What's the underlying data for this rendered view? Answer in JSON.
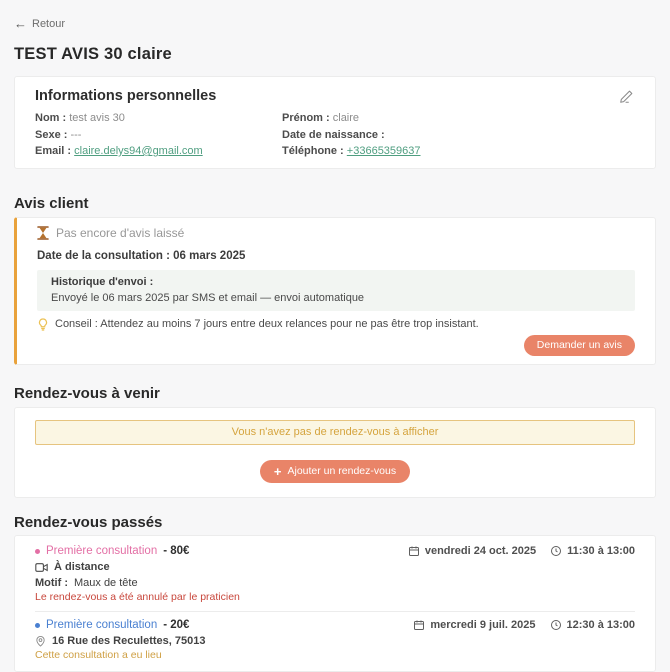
{
  "icons": {
    "back_arrow": "←",
    "plus": "+"
  },
  "header": {
    "back_label": "Retour",
    "title": "TEST AVIS 30 claire"
  },
  "personal_info": {
    "title": "Informations personnelles",
    "nom_label": "Nom :",
    "nom_value": "test avis 30",
    "prenom_label": "Prénom :",
    "prenom_value": "claire",
    "sexe_label": "Sexe :",
    "sexe_value": "---",
    "naissance_label": "Date de naissance :",
    "naissance_value": "",
    "email_label": "Email :",
    "email_value": "claire.delys94@gmail.com",
    "telephone_label": "Téléphone :",
    "telephone_value": "+33665359637"
  },
  "avis_client": {
    "section_title": "Avis client",
    "empty_state": "Pas encore d'avis laissé",
    "consultation_date_label": "Date de la consultation :",
    "consultation_date_value": "06 mars 2025",
    "history_title": "Historique d'envoi :",
    "history_entry": "Envoyé le 06 mars 2025 par SMS et email — envoi automatique",
    "tip_text": "Conseil : Attendez au moins 7 jours entre deux relances pour ne pas être trop insistant.",
    "request_button_label": "Demander un avis"
  },
  "upcoming": {
    "section_title": "Rendez-vous à venir",
    "empty_banner": "Vous n'avez pas de rendez-vous à afficher",
    "add_button_label": "Ajouter un rendez-vous"
  },
  "past": {
    "section_title": "Rendez-vous passés",
    "appointments": [
      {
        "type": "Première consultation",
        "price": "- 80€",
        "date": "vendredi 24 oct. 2025",
        "time": "11:30 à 13:00",
        "mode": "À distance",
        "motif_label": "Motif :",
        "motif_value": "Maux de tête",
        "status": "Le rendez-vous a été annulé par le praticien",
        "accent_color": "#e36fa5",
        "status_color": "#c8473c"
      },
      {
        "type": "Première consultation",
        "price": "- 20€",
        "date": "mercredi 9 juil. 2025",
        "time": "12:30 à 13:00",
        "location": "16 Rue des Reculettes, 75013",
        "status": "Cette consultation a eu lieu",
        "accent_color": "#4a80d1",
        "status_color": "#cfa045"
      }
    ]
  },
  "colors": {
    "accent_button": "#e98468",
    "avis_card_border": "#e9a23b",
    "link_green": "#4f9e80",
    "banner_text": "#d5a43e",
    "page_background": "#f7f7f8"
  }
}
